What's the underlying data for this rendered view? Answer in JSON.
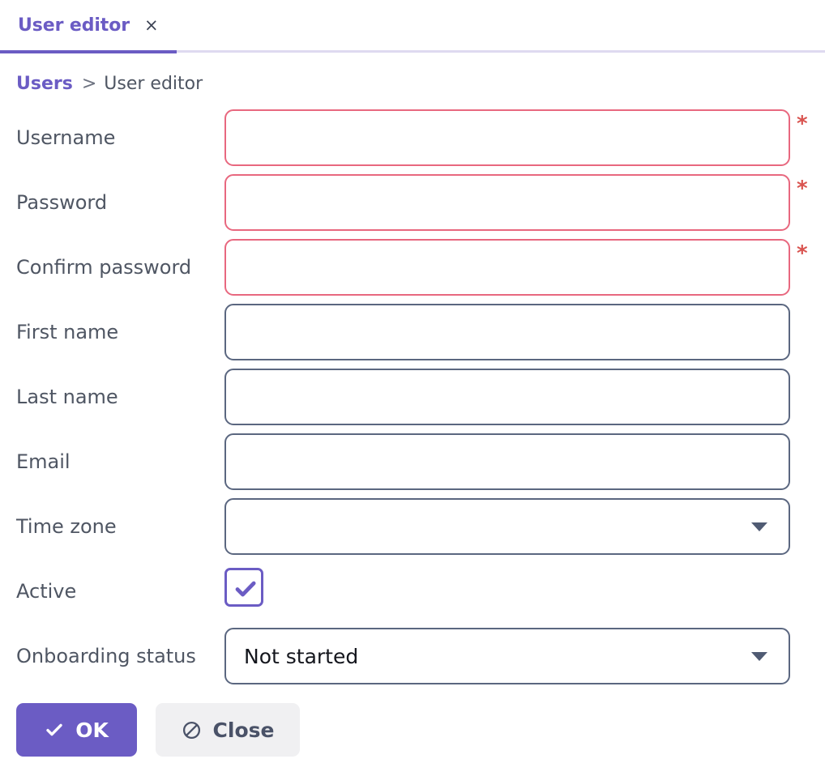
{
  "tab": {
    "label": "User editor",
    "close_glyph": "×"
  },
  "breadcrumb": {
    "parent": "Users",
    "separator": ">",
    "current": "User editor"
  },
  "form": {
    "rows": [
      {
        "label": "Username",
        "type": "text",
        "value": "",
        "required": true,
        "star": "*"
      },
      {
        "label": "Password",
        "type": "text",
        "value": "",
        "required": true,
        "star": "*"
      },
      {
        "label": "Confirm password",
        "type": "text",
        "value": "",
        "required": true,
        "star": "*"
      },
      {
        "label": "First name",
        "type": "text",
        "value": "",
        "required": false
      },
      {
        "label": "Last name",
        "type": "text",
        "value": "",
        "required": false
      },
      {
        "label": "Email",
        "type": "text",
        "value": "",
        "required": false
      },
      {
        "label": "Time zone",
        "type": "select",
        "value": "",
        "required": false
      },
      {
        "label": "Active",
        "type": "checkbox",
        "checked": true,
        "required": false
      },
      {
        "label": "Onboarding status",
        "type": "select",
        "value": "Not started",
        "required": false
      }
    ]
  },
  "buttons": {
    "ok": {
      "label": "OK",
      "icon": "check-icon"
    },
    "close": {
      "label": "Close",
      "icon": "ban-icon"
    }
  },
  "colors": {
    "accent_purple": "#6b5cc4",
    "tab_baseline": "#dedaf0",
    "required_border": "#e8687f",
    "required_star": "#d9534f",
    "field_border": "#5b6780",
    "label_text": "#4f5663",
    "close_btn_bg": "#f0f0f2"
  }
}
